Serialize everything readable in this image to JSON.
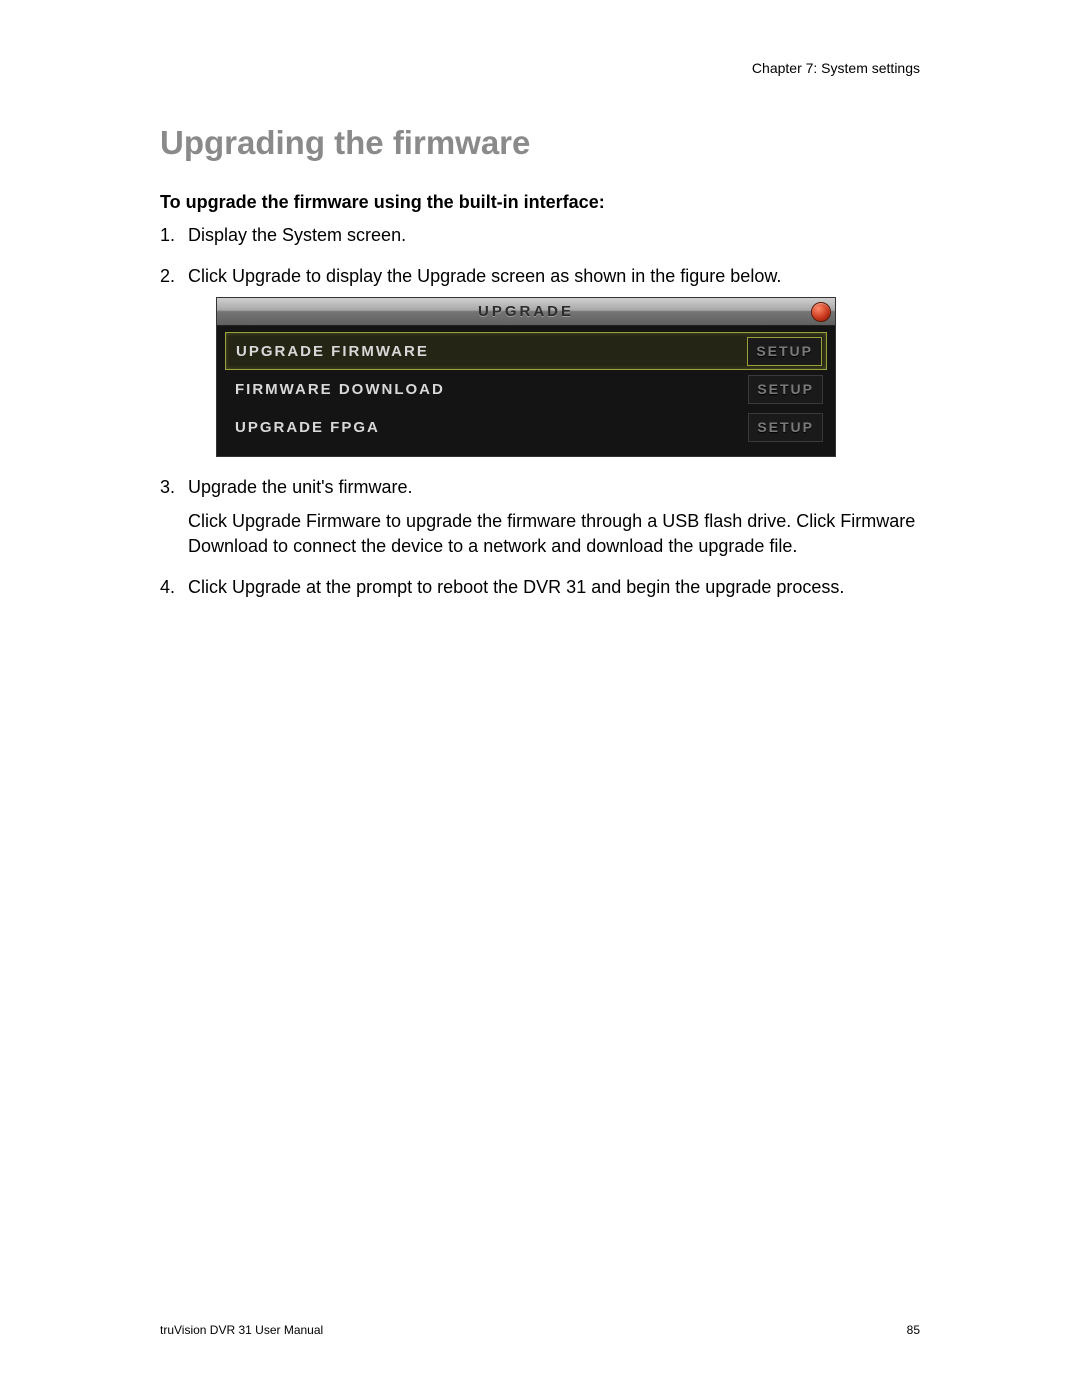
{
  "header": {
    "chapter": "Chapter 7: System settings"
  },
  "heading": "Upgrading the firmware",
  "subheading": "To upgrade the firmware using the built-in interface:",
  "steps": {
    "s1": {
      "num": "1.",
      "text": "Display the System screen."
    },
    "s2": {
      "num": "2.",
      "text": "Click Upgrade to display the Upgrade screen as shown in the figure below."
    },
    "s3": {
      "num": "3.",
      "line1": "Upgrade the unit's firmware.",
      "line2": "Click Upgrade Firmware to upgrade the firmware through a USB flash drive. Click Firmware Download to connect the device to a network and download the upgrade file."
    },
    "s4": {
      "num": "4.",
      "text": "Click Upgrade at the prompt to reboot the DVR 31 and begin the upgrade process."
    }
  },
  "dvr": {
    "title": "UPGRADE",
    "rows": {
      "r0": {
        "label": "UPGRADE FIRMWARE",
        "button": "SETUP"
      },
      "r1": {
        "label": "FIRMWARE DOWNLOAD",
        "button": "SETUP"
      },
      "r2": {
        "label": "UPGRADE FPGA",
        "button": "SETUP"
      }
    }
  },
  "footer": {
    "left": "truVision DVR 31 User Manual",
    "right": "85"
  }
}
